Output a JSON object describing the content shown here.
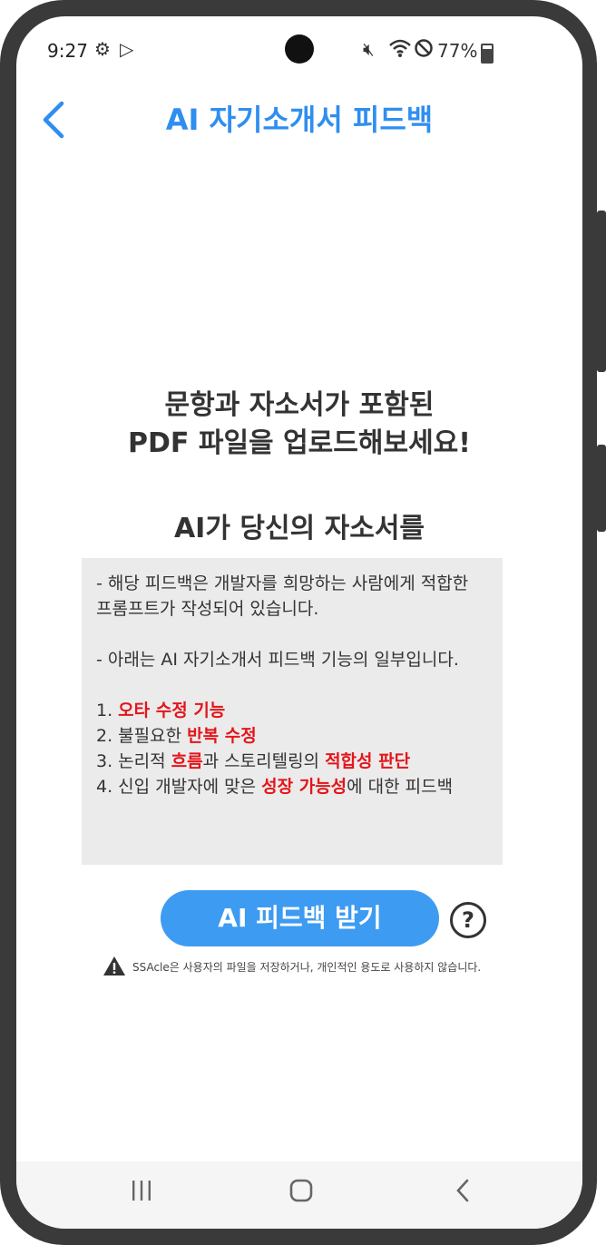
{
  "status_bar": {
    "time": "9:27",
    "battery_percent": "77%",
    "battery_level": 0.77,
    "icons": [
      "settings-icon",
      "play-store-icon",
      "mute-icon",
      "wifi-icon",
      "dnd-icon",
      "battery-icon"
    ]
  },
  "header": {
    "title": "AI 자기소개서 피드백",
    "back_icon": "chevron-left-icon"
  },
  "main": {
    "headline": [
      "문항과 자소서가 포함된",
      "PDF 파일을 업로드해보세요!"
    ],
    "subline": "AI가 당신의 자소서를"
  },
  "tooltip": {
    "intro1": " - 해당 피드백은 개발자를 희망하는 사람에게 적합한 프롬프트가 작성되어 있습니다.",
    "intro2": " - 아래는 AI 자기소개서 피드백 기능의 일부입니다.",
    "items": [
      {
        "prefix": " 1. ",
        "red1": "오타 수정 기능",
        "mid": "",
        "red2": "",
        "suffix": ""
      },
      {
        "prefix": " 2. 불필요한 ",
        "red1": "반복 수정",
        "mid": "",
        "red2": "",
        "suffix": ""
      },
      {
        "prefix": " 3. 논리적 ",
        "red1": "흐름",
        "mid": "과 스토리텔링의 ",
        "red2": "적합성 판단",
        "suffix": ""
      },
      {
        "prefix": " 4. 신입 개발자에 맞은 ",
        "red1": "성장 가능성",
        "mid": "에 대한 피드백",
        "red2": "",
        "suffix": ""
      }
    ],
    "accent_color": "#e3151b"
  },
  "actions": {
    "feedback_button": "AI 피드백 받기",
    "help_label": "?"
  },
  "notice": {
    "text": "SSAcle은 사용자의 파일을 저장하거나, 개인적인 용도로 사용하지 않습니다."
  },
  "nav_bar": {
    "recents": "|||",
    "home": "◯",
    "back": "<"
  },
  "colors": {
    "primary": "#2f8ef0",
    "button": "#3d9bf2",
    "text": "#333333"
  }
}
